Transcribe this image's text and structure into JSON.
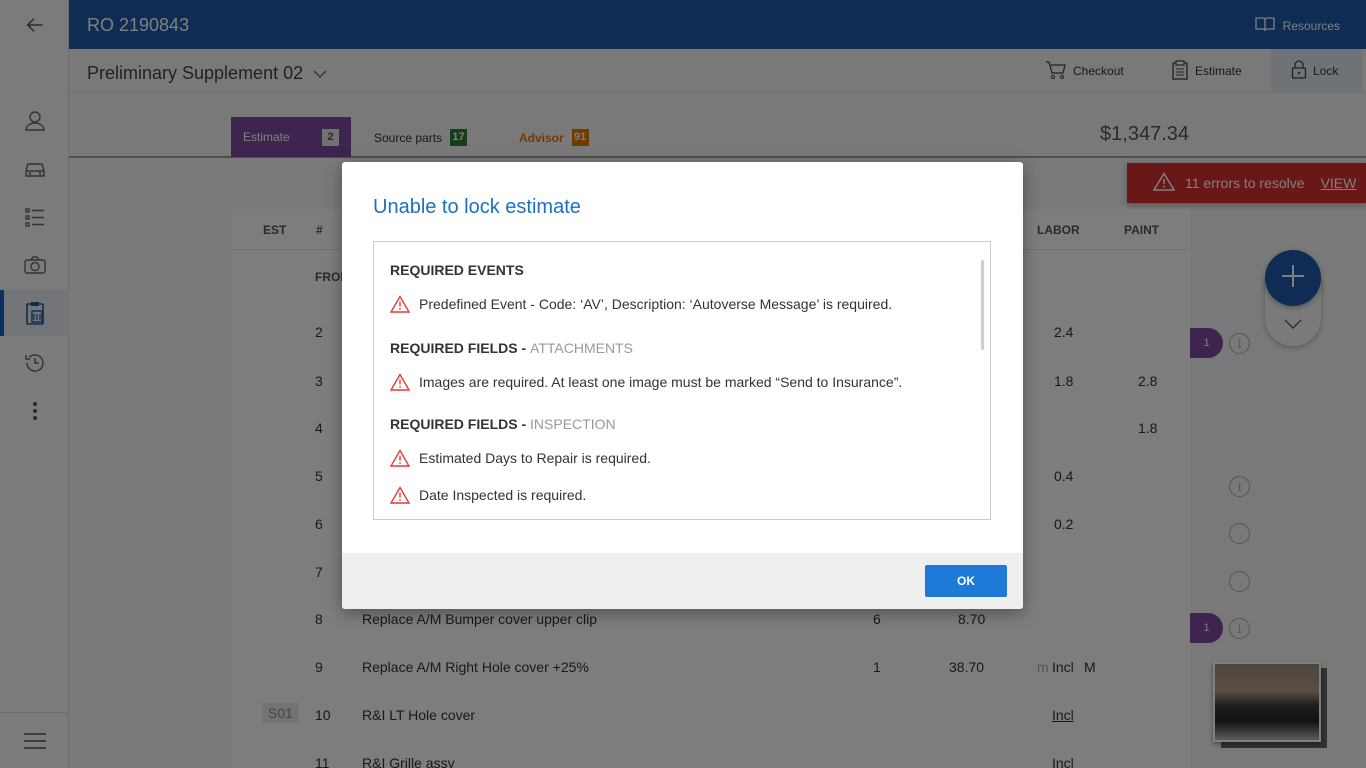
{
  "header": {
    "ro_number": "RO 2190843",
    "resources_label": "Resources"
  },
  "subheader": {
    "title": "Preliminary Supplement 02",
    "checkout_label": "Checkout",
    "estimate_label": "Estimate",
    "lock_label": "Lock"
  },
  "tabs": {
    "estimate": {
      "label": "Estimate",
      "count": "2"
    },
    "source_parts": {
      "label": "Source parts",
      "count": "17"
    },
    "advisor": {
      "label": "Advisor",
      "count": "91"
    }
  },
  "total": "$1,347.34",
  "error_banner": {
    "text": "11 errors to resolve",
    "view_label": "VIEW"
  },
  "table": {
    "headers": {
      "est": "EST",
      "num": "#",
      "labor": "LABOR",
      "paint": "PAINT"
    },
    "group_label": "FRON",
    "rows": [
      {
        "num": "2",
        "labor": "2.4",
        "paint": ""
      },
      {
        "num": "3",
        "labor": "1.8",
        "paint": "2.8"
      },
      {
        "num": "4",
        "labor": "",
        "paint": "1.8"
      },
      {
        "num": "5",
        "labor": "0.4",
        "paint": ""
      },
      {
        "num": "6",
        "labor": "0.2",
        "paint": ""
      },
      {
        "num": "7",
        "labor": "",
        "paint": ""
      },
      {
        "num": "8",
        "desc": "Replace A/M Bumper cover upper clip",
        "qty": "6",
        "price": "8.70"
      },
      {
        "num": "9",
        "desc": "Replace A/M Right Hole cover +25%",
        "qty": "1",
        "price": "38.70",
        "prefix": "m",
        "labor": "Incl",
        "suffix": "M"
      },
      {
        "est": "S01",
        "num": "10",
        "desc": "R&I LT Hole cover",
        "labor": "Incl"
      },
      {
        "num": "11",
        "desc": "R&I Grille assy",
        "labor": "Incl"
      }
    ]
  },
  "side": {
    "pill_count": "1",
    "info": "i"
  },
  "modal": {
    "title": "Unable to lock estimate",
    "sections": [
      {
        "heading": "REQUIRED EVENTS",
        "sub": ""
      },
      {
        "heading": "REQUIRED FIELDS - ",
        "sub": "ATTACHMENTS"
      },
      {
        "heading": "REQUIRED FIELDS - ",
        "sub": "INSPECTION"
      }
    ],
    "messages": [
      "Predefined Event - Code: ‘AV’, Description: ‘Autoverse Message’ is required.",
      "Images are required. At least one image must be marked “Send to Insurance”.",
      "Estimated Days to Repair is required.",
      "Date Inspected is required."
    ],
    "ok_label": "OK"
  },
  "colors": {
    "brand_blue": "#1e5aa8",
    "error_red": "#d32f2f",
    "purple": "#7b4aa1",
    "advisor_orange": "#e07700",
    "parts_green": "#2e7d32"
  },
  "icons": [
    "back-arrow-icon",
    "book-icon",
    "cart-icon",
    "document-icon",
    "lock-icon",
    "user-icon",
    "car-icon",
    "list-icon",
    "camera-icon",
    "clipboard-icon",
    "history-icon",
    "more-vertical-icon",
    "menu-icon",
    "warning-icon",
    "plus-icon",
    "chevron-down-icon",
    "info-icon"
  ]
}
